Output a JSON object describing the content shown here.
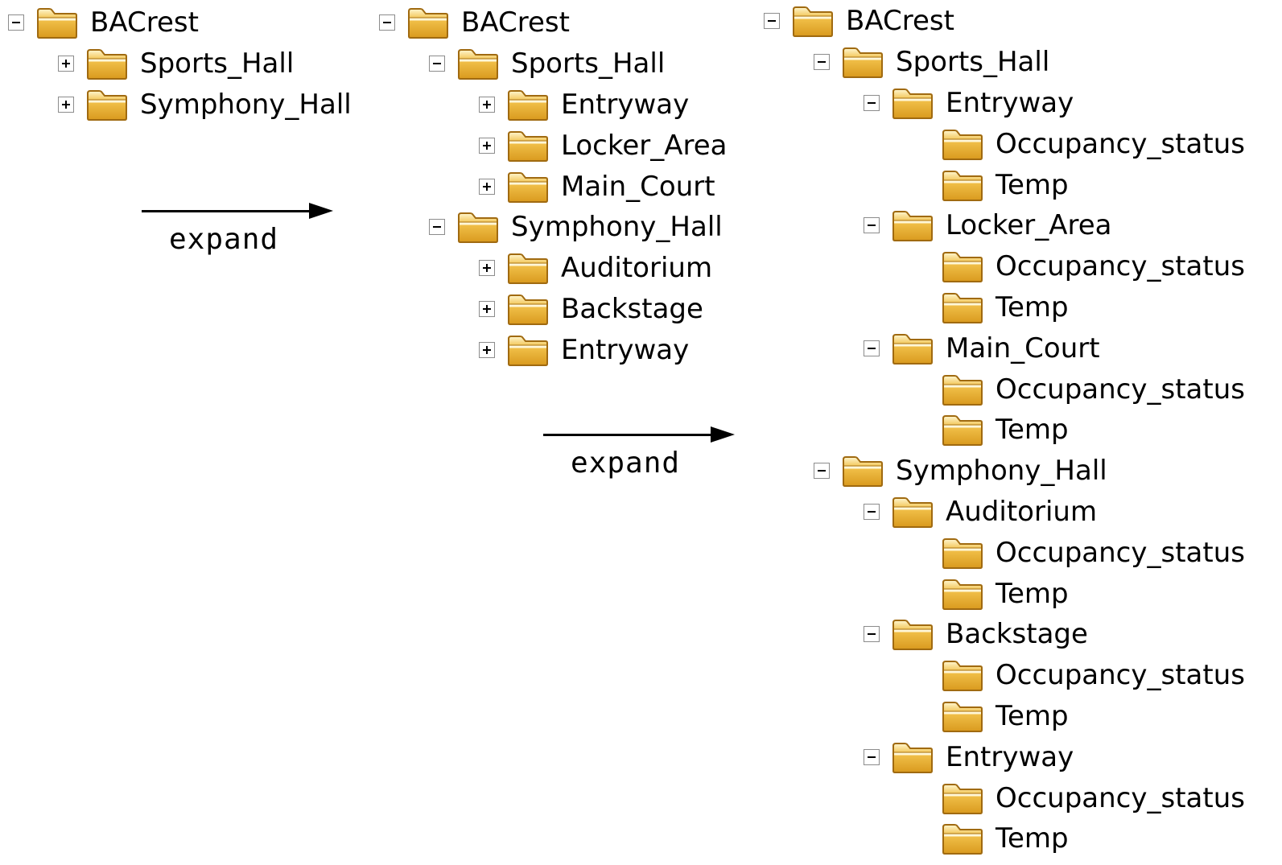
{
  "colors": {
    "folder_fill": "#f2c24c",
    "folder_stroke": "#a06a10",
    "toggle_border": "#8c8c8c"
  },
  "icons": {
    "collapse": "minus-box-icon",
    "expand": "plus-box-icon",
    "folder": "folder-icon"
  },
  "arrows": [
    {
      "label": "expand"
    },
    {
      "label": "expand"
    }
  ],
  "trees": [
    {
      "nodes": [
        {
          "label": "BACrest",
          "level": 0,
          "toggle": "minus"
        },
        {
          "label": "Sports_Hall",
          "level": 1,
          "toggle": "plus"
        },
        {
          "label": "Symphony_Hall",
          "level": 1,
          "toggle": "plus"
        }
      ]
    },
    {
      "nodes": [
        {
          "label": "BACrest",
          "level": 0,
          "toggle": "minus"
        },
        {
          "label": "Sports_Hall",
          "level": 1,
          "toggle": "minus"
        },
        {
          "label": "Entryway",
          "level": 2,
          "toggle": "plus"
        },
        {
          "label": "Locker_Area",
          "level": 2,
          "toggle": "plus"
        },
        {
          "label": "Main_Court",
          "level": 2,
          "toggle": "plus"
        },
        {
          "label": "Symphony_Hall",
          "level": 1,
          "toggle": "minus"
        },
        {
          "label": "Auditorium",
          "level": 2,
          "toggle": "plus"
        },
        {
          "label": "Backstage",
          "level": 2,
          "toggle": "plus"
        },
        {
          "label": "Entryway",
          "level": 2,
          "toggle": "plus"
        }
      ]
    },
    {
      "nodes": [
        {
          "label": "BACrest",
          "level": 0,
          "toggle": "minus"
        },
        {
          "label": "Sports_Hall",
          "level": 1,
          "toggle": "minus"
        },
        {
          "label": "Entryway",
          "level": 2,
          "toggle": "minus"
        },
        {
          "label": "Occupancy_status",
          "level": 3,
          "toggle": "none"
        },
        {
          "label": "Temp",
          "level": 3,
          "toggle": "none"
        },
        {
          "label": "Locker_Area",
          "level": 2,
          "toggle": "minus"
        },
        {
          "label": "Occupancy_status",
          "level": 3,
          "toggle": "none"
        },
        {
          "label": "Temp",
          "level": 3,
          "toggle": "none"
        },
        {
          "label": "Main_Court",
          "level": 2,
          "toggle": "minus"
        },
        {
          "label": "Occupancy_status",
          "level": 3,
          "toggle": "none"
        },
        {
          "label": "Temp",
          "level": 3,
          "toggle": "none"
        },
        {
          "label": "Symphony_Hall",
          "level": 1,
          "toggle": "minus"
        },
        {
          "label": "Auditorium",
          "level": 2,
          "toggle": "minus"
        },
        {
          "label": "Occupancy_status",
          "level": 3,
          "toggle": "none"
        },
        {
          "label": "Temp",
          "level": 3,
          "toggle": "none"
        },
        {
          "label": "Backstage",
          "level": 2,
          "toggle": "minus"
        },
        {
          "label": "Occupancy_status",
          "level": 3,
          "toggle": "none"
        },
        {
          "label": "Temp",
          "level": 3,
          "toggle": "none"
        },
        {
          "label": "Entryway",
          "level": 2,
          "toggle": "minus"
        },
        {
          "label": "Occupancy_status",
          "level": 3,
          "toggle": "none"
        },
        {
          "label": "Temp",
          "level": 3,
          "toggle": "none"
        }
      ]
    }
  ]
}
